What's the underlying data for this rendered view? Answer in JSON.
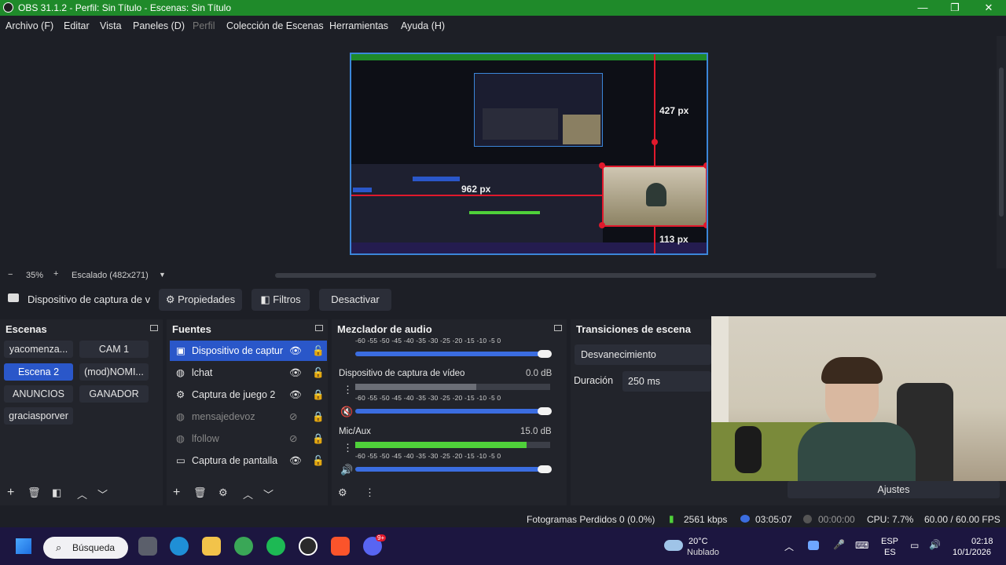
{
  "window": {
    "title": "OBS 31.1.2 - Perfil: Sin Título - Escenas: Sin Título",
    "minimize": "—",
    "maximize": "❐",
    "close": "✕"
  },
  "menu": [
    "Archivo (F)",
    "Editar",
    "Vista",
    "Paneles (D)",
    "Perfil",
    "Colección de Escenas",
    "Herramientas",
    "Ayuda (H)"
  ],
  "preview": {
    "guide_top": "427 px",
    "guide_left": "962 px",
    "guide_bottom": "113 px"
  },
  "zoom": {
    "minus": "−",
    "level": "35%",
    "plus": "+",
    "scaling": "Escalado (482x271)",
    "dropdown": "▼"
  },
  "context": {
    "source_name": "Dispositivo de captura de v",
    "properties": "Propiedades",
    "filters": "Filtros",
    "deactivate": "Desactivar"
  },
  "scenes": {
    "title": "Escenas",
    "items": [
      "yacomenza...",
      "CAM 1",
      "Escena 2",
      "(mod)NOMI...",
      "ANUNCIOS",
      "GANADOR",
      "graciasporver"
    ],
    "active": "Escena 2"
  },
  "sources": {
    "title": "Fuentes",
    "items": [
      {
        "name": "Dispositivo de captur",
        "icon": "camera-icon",
        "visible": true,
        "locked": false
      },
      {
        "name": "lchat",
        "icon": "browser-icon",
        "visible": true,
        "locked": false
      },
      {
        "name": "Captura de juego 2",
        "icon": "gamepad-icon",
        "visible": true,
        "locked": true
      },
      {
        "name": "mensajedevoz",
        "icon": "browser-icon",
        "visible": false,
        "locked": true
      },
      {
        "name": "lfollow",
        "icon": "browser-icon",
        "visible": false,
        "locked": true
      },
      {
        "name": "Captura de pantalla",
        "icon": "monitor-icon",
        "visible": true,
        "locked": false
      }
    ]
  },
  "mixer": {
    "title": "Mezclador de audio",
    "scale": "-60  -55  -50  -45  -40  -35  -30  -25  -20  -15  -10   -5    0",
    "channels": [
      {
        "name": "Dispositivo de captura de vídeo",
        "db": "0.0 dB",
        "level": 0.62
      },
      {
        "name": "Mic/Aux",
        "db": "15.0 dB",
        "level": 0.88
      }
    ]
  },
  "transitions": {
    "title": "Transiciones de escena",
    "selected": "Desvanecimiento",
    "duration_label": "Duración",
    "duration_value": "250 ms"
  },
  "controls": {
    "settings": "Ajustes"
  },
  "status": {
    "dropped_frames": "Fotogramas Perdidos 0 (0.0%)",
    "bitrate": "2561 kbps",
    "stream_time": "03:05:07",
    "rec_time": "00:00:00",
    "cpu": "CPU: 7.7%",
    "fps": "60.00 / 60.00 FPS"
  },
  "taskbar": {
    "search": "Búsqueda",
    "weather_temp": "20°C",
    "weather_desc": "Nublado",
    "lang_top": "ESP",
    "lang_bottom": "ES",
    "time": "02:18",
    "date": "10/1/2026",
    "badge_discord": "9+"
  },
  "colors": {
    "accent": "#2a57c9",
    "titlebar": "#1f8a2a",
    "guide": "#e0192c",
    "meter_green": "#4fd13a"
  }
}
